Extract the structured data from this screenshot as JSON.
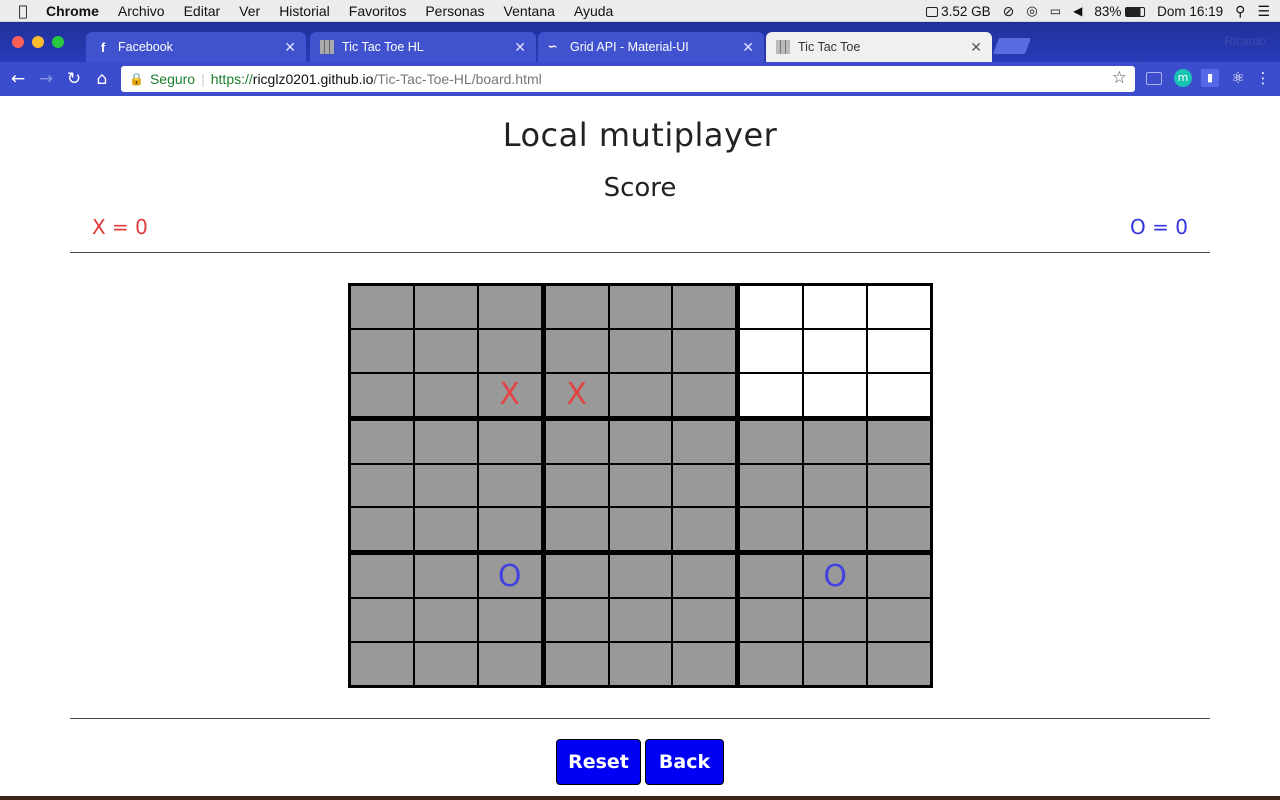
{
  "menubar": {
    "items": [
      "Chrome",
      "Archivo",
      "Editar",
      "Ver",
      "Historial",
      "Favoritos",
      "Personas",
      "Ventana",
      "Ayuda"
    ],
    "memory": "3.52 GB",
    "battery": "83%",
    "clock": "Dom 16:19"
  },
  "tabs": [
    {
      "label": "Facebook",
      "icon": "facebook-icon",
      "active": false
    },
    {
      "label": "Tic Tac Toe HL",
      "icon": "grid-favicon",
      "active": false
    },
    {
      "label": "Grid API - Material-UI",
      "icon": "material-ui-icon",
      "active": false
    },
    {
      "label": "Tic Tac Toe",
      "icon": "grid-favicon",
      "active": true
    }
  ],
  "profile_name": "Ricardo",
  "address_bar": {
    "secure_label": "Seguro",
    "scheme": "https://",
    "host": "ricglz0201.github.io",
    "path": "/Tic-Tac-Toe-HL/board.html"
  },
  "page": {
    "title": "Local mutiplayer",
    "score_heading": "Score",
    "score_x": "X =  0",
    "score_o": "O = 0",
    "reset_label": "Reset",
    "back_label": "Back",
    "colors": {
      "x": "#e24444",
      "o": "#4242e0",
      "button": "#0000f5",
      "cell": "#999999",
      "open_cell": "#ffffff"
    }
  },
  "board": [
    {
      "open": false,
      "cells": [
        "",
        "",
        "",
        "",
        "",
        "",
        "",
        "",
        "X"
      ]
    },
    {
      "open": false,
      "cells": [
        "",
        "",
        "",
        "",
        "",
        "",
        "X",
        "",
        ""
      ]
    },
    {
      "open": true,
      "cells": [
        "",
        "",
        "",
        "",
        "",
        "",
        "",
        "",
        ""
      ]
    },
    {
      "open": false,
      "cells": [
        "",
        "",
        "",
        "",
        "",
        "",
        "",
        "",
        ""
      ]
    },
    {
      "open": false,
      "cells": [
        "",
        "",
        "",
        "",
        "",
        "",
        "",
        "",
        ""
      ]
    },
    {
      "open": false,
      "cells": [
        "",
        "",
        "",
        "",
        "",
        "",
        "",
        "",
        ""
      ]
    },
    {
      "open": false,
      "cells": [
        "",
        "",
        "O",
        "",
        "",
        "",
        "",
        "",
        ""
      ]
    },
    {
      "open": false,
      "cells": [
        "",
        "",
        "",
        "",
        "",
        "",
        "",
        "",
        ""
      ]
    },
    {
      "open": false,
      "cells": [
        "",
        "O",
        "",
        "",
        "",
        "",
        "",
        "",
        ""
      ]
    }
  ]
}
